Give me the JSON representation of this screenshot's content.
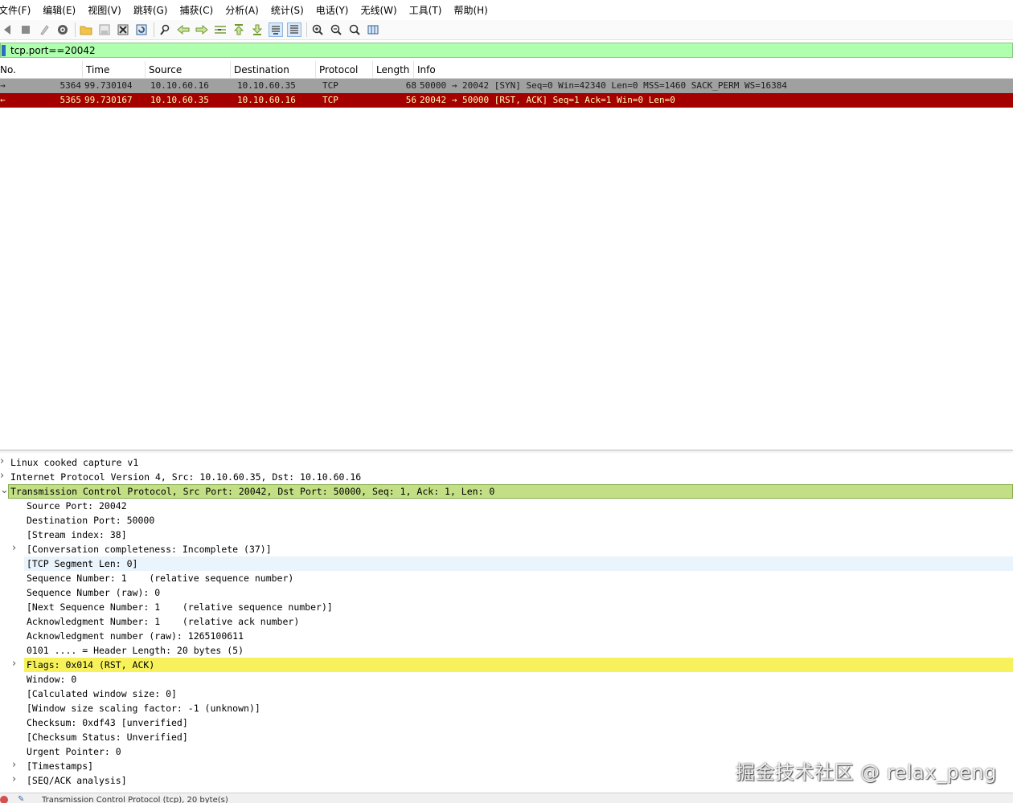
{
  "menu": [
    "文件(F)",
    "编辑(E)",
    "视图(V)",
    "跳转(G)",
    "捕获(C)",
    "分析(A)",
    "统计(S)",
    "电话(Y)",
    "无线(W)",
    "工具(T)",
    "帮助(H)"
  ],
  "toolbar": {
    "icons": [
      "start-capture-icon",
      "stop-capture-icon",
      "restart-capture-icon",
      "capture-options-icon",
      "open-file-icon",
      "save-file-icon",
      "close-file-icon",
      "reload-file-icon",
      "find-packet-icon",
      "go-back-icon",
      "go-forward-icon",
      "go-to-packet-icon",
      "go-first-icon",
      "go-last-icon",
      "auto-scroll-icon",
      "colorize-icon",
      "zoom-in-icon",
      "zoom-out-icon",
      "zoom-normal-icon",
      "resize-columns-icon"
    ]
  },
  "filter": {
    "value": "tcp.port==20042"
  },
  "packet_list": {
    "columns": [
      "No.",
      "Time",
      "Source",
      "Destination",
      "Protocol",
      "Length",
      "Info"
    ],
    "rows": [
      {
        "mark": "→",
        "no": "5364",
        "time": "99.730104",
        "source": "10.10.60.16",
        "destination": "10.10.60.35",
        "protocol": "TCP",
        "length": "68",
        "info": "50000 → 20042 [SYN] Seq=0 Win=42340 Len=0 MSS=1460 SACK_PERM WS=16384"
      },
      {
        "mark": "←",
        "no": "5365",
        "time": "99.730167",
        "source": "10.10.60.35",
        "destination": "10.10.60.16",
        "protocol": "TCP",
        "length": "56",
        "info": "20042 → 50000 [RST, ACK] Seq=1 Ack=1 Win=0 Len=0"
      }
    ]
  },
  "details": {
    "lines": [
      {
        "text": "Linux cooked capture v1",
        "level": 0,
        "arrow": ">",
        "highlight": ""
      },
      {
        "text": "Internet Protocol Version 4, Src: 10.10.60.35, Dst: 10.10.60.16",
        "level": 0,
        "arrow": ">",
        "highlight": ""
      },
      {
        "text": "Transmission Control Protocol, Src Port: 20042, Dst Port: 50000, Seq: 1, Ack: 1, Len: 0",
        "level": 0,
        "arrow": "v",
        "highlight": "tcp"
      },
      {
        "text": "Source Port: 20042",
        "level": 1,
        "arrow": "",
        "highlight": ""
      },
      {
        "text": "Destination Port: 50000",
        "level": 1,
        "arrow": "",
        "highlight": ""
      },
      {
        "text": "[Stream index: 38]",
        "level": 1,
        "arrow": "",
        "highlight": ""
      },
      {
        "text": "[Conversation completeness: Incomplete (37)]",
        "level": 1,
        "arrow": ">",
        "highlight": ""
      },
      {
        "text": "[TCP Segment Len: 0]",
        "level": 1,
        "arrow": "",
        "highlight": "seg"
      },
      {
        "text": "Sequence Number: 1    (relative sequence number)",
        "level": 1,
        "arrow": "",
        "highlight": ""
      },
      {
        "text": "Sequence Number (raw): 0",
        "level": 1,
        "arrow": "",
        "highlight": ""
      },
      {
        "text": "[Next Sequence Number: 1    (relative sequence number)]",
        "level": 1,
        "arrow": "",
        "highlight": ""
      },
      {
        "text": "Acknowledgment Number: 1    (relative ack number)",
        "level": 1,
        "arrow": "",
        "highlight": ""
      },
      {
        "text": "Acknowledgment number (raw): 1265100611",
        "level": 1,
        "arrow": "",
        "highlight": ""
      },
      {
        "text": "0101 .... = Header Length: 20 bytes (5)",
        "level": 1,
        "arrow": "",
        "highlight": ""
      },
      {
        "text": "Flags: 0x014 (RST, ACK)",
        "level": 1,
        "arrow": ">",
        "highlight": "flags"
      },
      {
        "text": "Window: 0",
        "level": 1,
        "arrow": "",
        "highlight": ""
      },
      {
        "text": "[Calculated window size: 0]",
        "level": 1,
        "arrow": "",
        "highlight": ""
      },
      {
        "text": "[Window size scaling factor: -1 (unknown)]",
        "level": 1,
        "arrow": "",
        "highlight": ""
      },
      {
        "text": "Checksum: 0xdf43 [unverified]",
        "level": 1,
        "arrow": "",
        "highlight": ""
      },
      {
        "text": "[Checksum Status: Unverified]",
        "level": 1,
        "arrow": "",
        "highlight": ""
      },
      {
        "text": "Urgent Pointer: 0",
        "level": 1,
        "arrow": "",
        "highlight": ""
      },
      {
        "text": "[Timestamps]",
        "level": 1,
        "arrow": ">",
        "highlight": ""
      },
      {
        "text": "[SEQ/ACK analysis]",
        "level": 1,
        "arrow": ">",
        "highlight": ""
      }
    ]
  },
  "status": {
    "text": "Transmission Control Protocol (tcp), 20 byte(s)"
  },
  "watermark": "掘金技术社区 @ relax_peng",
  "colors": {
    "filter_valid": "#afffaf",
    "rst_row": "#a40000",
    "syn_row": "#a0a0a0",
    "flags_highlight": "#f7f25b",
    "tcp_selected": "#c2df86"
  }
}
